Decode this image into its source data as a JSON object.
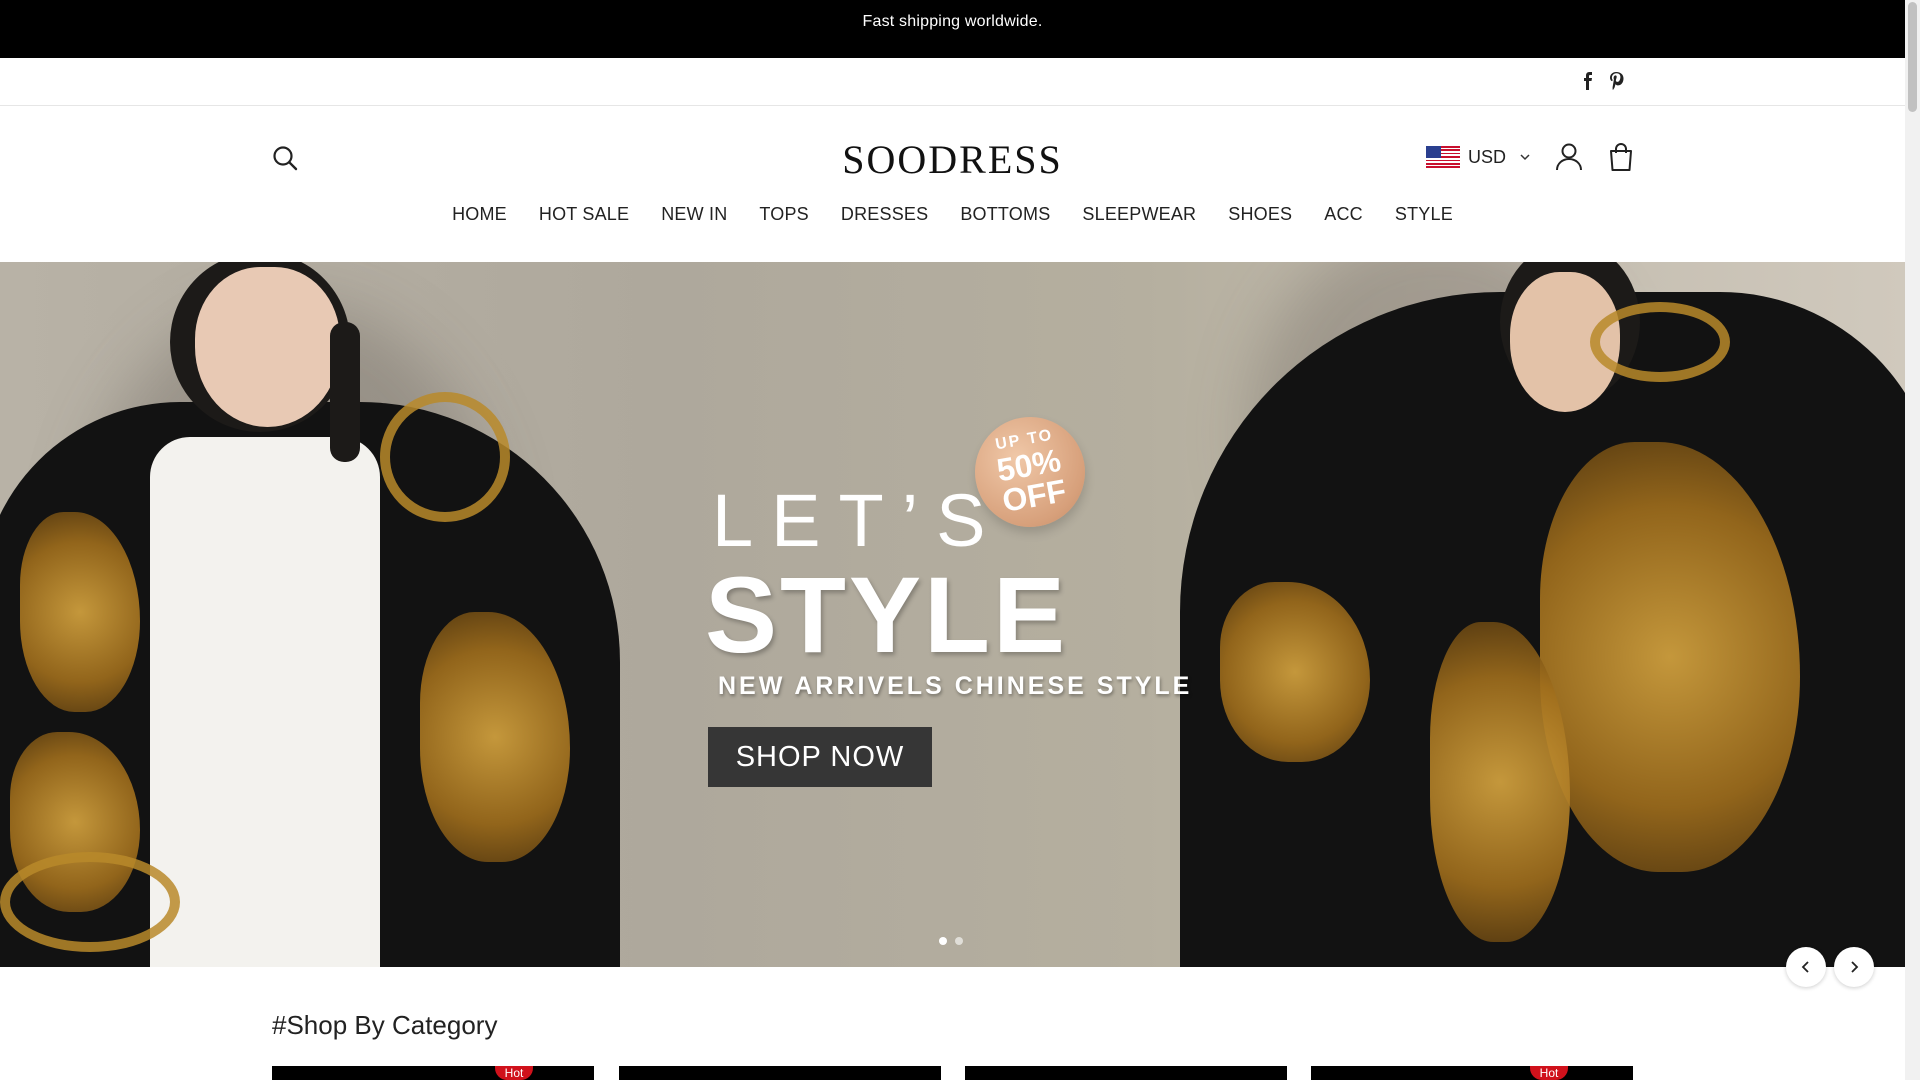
{
  "announcement": {
    "text": "Fast shipping worldwide."
  },
  "social": {
    "icons": [
      "facebook-icon",
      "pinterest-icon"
    ]
  },
  "header": {
    "logo": "SOODRESS",
    "currency": "USD",
    "icons": {
      "search": "search-icon",
      "account": "user-icon",
      "cart": "bag-icon"
    }
  },
  "nav": {
    "items": [
      "HOME",
      "HOT SALE",
      "NEW IN",
      "TOPS",
      "DRESSES",
      "BOTTOMS",
      "SLEEPWEAR",
      "SHOES",
      "ACC",
      "STYLE"
    ]
  },
  "hero": {
    "badge_top": "UP TO",
    "badge_mid": "50%",
    "badge_bot": "OFF",
    "headline_1": "LET’S",
    "headline_2": "STYLE",
    "subtitle": "NEW ARRIVELS CHINESE STYLE",
    "cta": "SHOP NOW",
    "slide_count": 2,
    "active_slide": 1
  },
  "section": {
    "title": "#Shop By Category"
  },
  "categories": [
    {
      "badge": "Hot"
    },
    {
      "badge": ""
    },
    {
      "badge": ""
    },
    {
      "badge": "Hot"
    }
  ],
  "colors": {
    "announcement_bg": "#000000",
    "cta_bg": "#363636",
    "hot_badge": "#d0111b"
  }
}
